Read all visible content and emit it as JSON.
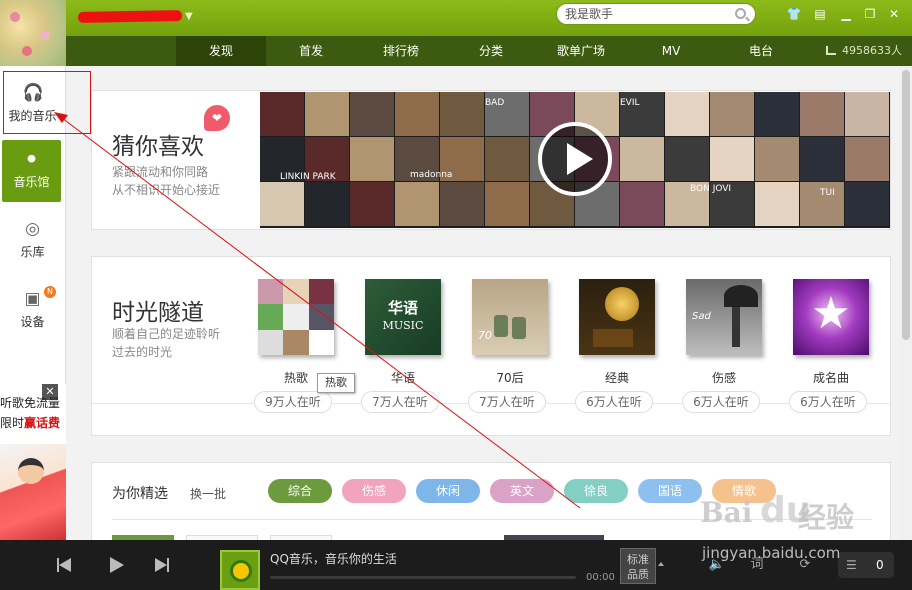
{
  "header": {
    "search_placeholder": "我是歌手",
    "window_buttons": [
      "skin-icon",
      "mini-mode-icon",
      "minimize-icon",
      "maximize-icon",
      "close-icon"
    ]
  },
  "nav": {
    "tabs": [
      {
        "label": "发现",
        "active": true
      },
      {
        "label": "首发",
        "active": false
      },
      {
        "label": "排行榜",
        "active": false
      },
      {
        "label": "分类",
        "active": false
      },
      {
        "label": "歌单广场",
        "active": false
      },
      {
        "label": "MV",
        "active": false
      },
      {
        "label": "电台",
        "active": false
      }
    ],
    "listener_count": "4958633人"
  },
  "sidebar": {
    "items": [
      {
        "label": "我的音乐",
        "icon": "headphones-icon"
      },
      {
        "label": "音乐馆",
        "icon": "music-hall-icon",
        "active": true
      },
      {
        "label": "乐库",
        "icon": "target-icon"
      },
      {
        "label": "设备",
        "icon": "device-icon",
        "badge": "N"
      }
    ],
    "promo": {
      "line1": "听歌免流量",
      "line2_prefix": "限时",
      "line2_highlight": "赢话费",
      "close": "✕"
    }
  },
  "guess": {
    "title": "猜你喜欢",
    "subtitle1": "紧跟流动和你同路",
    "subtitle2": "从不相识开始心接近",
    "mosaic_texts": [
      "BAD",
      "EVIL",
      "LINKIN PARK",
      "BON JOVI",
      "madonna",
      "TUI"
    ]
  },
  "time_tunnel": {
    "title": "时光隧道",
    "subtitle1": "顺着自己的足迹聆听",
    "subtitle2": "过去的时光",
    "albums": [
      {
        "name": "热歌",
        "listeners": "9万人在听",
        "theme": "collage"
      },
      {
        "name": "华语",
        "listeners": "7万人在听",
        "theme": "huayu",
        "cover_title": "华语",
        "cover_sub": "MUSIC"
      },
      {
        "name": "70后",
        "listeners": "7万人在听",
        "theme": "shoes",
        "cover_text": "70"
      },
      {
        "name": "经典",
        "listeners": "6万人在听",
        "theme": "gramophone"
      },
      {
        "name": "伤感",
        "listeners": "6万人在听",
        "theme": "sad",
        "cover_text": "Sad"
      },
      {
        "name": "成名曲",
        "listeners": "6万人在听",
        "theme": "star"
      }
    ],
    "tooltip": "热歌"
  },
  "picks": {
    "title": "为你精选",
    "refresh": "换一批",
    "tags": [
      {
        "label": "综合",
        "color": "#6c9b3e"
      },
      {
        "label": "伤感",
        "color": "#f2a3bd"
      },
      {
        "label": "休闲",
        "color": "#7fb6ea"
      },
      {
        "label": "英文",
        "color": "#d9a2c6"
      },
      {
        "label": "徐良",
        "color": "#84cfc4"
      },
      {
        "label": "国语",
        "color": "#8ec0ef"
      },
      {
        "label": "情歌",
        "color": "#f5c28e"
      }
    ]
  },
  "player": {
    "now_playing": "QQ音乐，音乐你的生活",
    "time": "00:00",
    "quality_line1": "标准",
    "quality_line2": "品质",
    "playlist_count": "0"
  },
  "watermark": {
    "brand_left": "Bai",
    "paw": "du",
    "brand_right": "经验",
    "url": "jingyan.baidu.com"
  },
  "colors": {
    "header_green": "#7fae12",
    "nav_dark": "#3d5b10",
    "active_green": "#6a9c12",
    "annotation_red": "#d11"
  }
}
